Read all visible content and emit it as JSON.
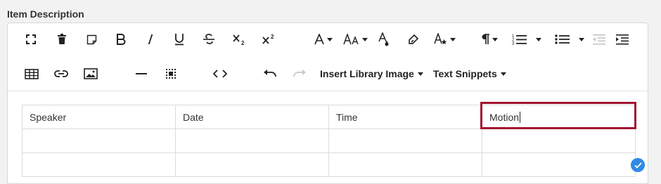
{
  "field_label": "Item Description",
  "toolbar": {
    "row1": [
      {
        "name": "fullscreen-icon"
      },
      {
        "name": "trash-icon"
      },
      {
        "name": "note-icon"
      },
      {
        "name": "bold-icon"
      },
      {
        "name": "italic-icon"
      },
      {
        "name": "underline-icon"
      },
      {
        "name": "strikethrough-icon"
      },
      {
        "name": "subscript-icon"
      },
      {
        "name": "superscript-icon"
      },
      {
        "name": "font-family-icon"
      },
      {
        "name": "font-size-icon"
      },
      {
        "name": "text-color-icon"
      },
      {
        "name": "highlight-icon"
      },
      {
        "name": "inline-style-icon"
      },
      {
        "name": "paragraph-format-icon"
      },
      {
        "name": "ordered-list-icon"
      },
      {
        "name": "unordered-list-icon"
      },
      {
        "name": "outdent-icon"
      },
      {
        "name": "indent-icon"
      }
    ],
    "row2": [
      {
        "name": "table-icon"
      },
      {
        "name": "link-icon"
      },
      {
        "name": "image-icon"
      },
      {
        "name": "horizontal-line-icon"
      },
      {
        "name": "select-all-icon"
      },
      {
        "name": "code-view-icon"
      },
      {
        "name": "undo-icon"
      },
      {
        "name": "redo-icon"
      }
    ],
    "insert_library_image_label": "Insert Library Image",
    "text_snippets_label": "Text Snippets"
  },
  "table": {
    "headers": [
      "Speaker",
      "Date",
      "Time",
      "Motion"
    ],
    "rows": [
      [
        "",
        "",
        "",
        ""
      ],
      [
        "",
        "",
        "",
        ""
      ]
    ]
  },
  "colors": {
    "highlight_border": "#a3132f",
    "status_badge": "#2f8ae5"
  }
}
